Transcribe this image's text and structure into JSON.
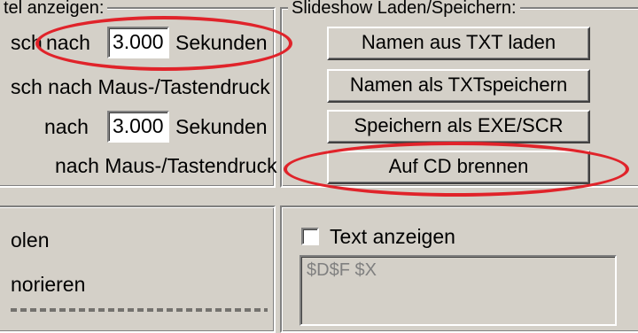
{
  "left_group": {
    "legend": "tel anzeigen:",
    "row1": {
      "prefix": "sch",
      "label": "nach",
      "value": "3.000",
      "unit": "Sekunden"
    },
    "row2": {
      "label": "sch nach Maus-/Tastendruck"
    },
    "row3": {
      "label": "nach",
      "value": "3.000",
      "unit": "Sekunden"
    },
    "row4": {
      "label": "nach Maus-/Tastendruck"
    }
  },
  "slideshow_group": {
    "legend": "Slideshow Laden/Speichern:",
    "buttons": [
      {
        "label": "Namen aus TXT laden"
      },
      {
        "label": "Namen als TXTspeichern"
      },
      {
        "label": "Speichern als EXE/SCR"
      },
      {
        "label": "Auf CD brennen"
      }
    ]
  },
  "lower_left": {
    "items": [
      {
        "label": "olen"
      },
      {
        "label": "norieren"
      }
    ]
  },
  "text_group": {
    "checkbox_label": "Text anzeigen",
    "checked": false,
    "text_value": "$D$F $X"
  },
  "colors": {
    "background": "#d4d0c8",
    "highlight_ellipse": "#e0232a"
  }
}
